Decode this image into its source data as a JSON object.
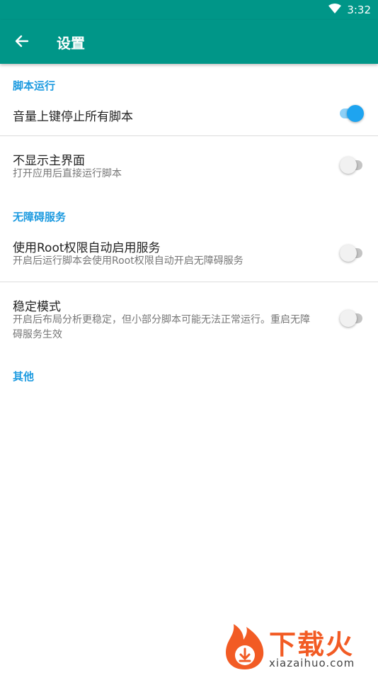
{
  "status_bar": {
    "time": "3:32",
    "icons": [
      "wifi-icon"
    ]
  },
  "app_bar": {
    "title": "设置",
    "back_icon": "arrow-back-icon"
  },
  "sections": {
    "script_run": {
      "header": "脚本运行",
      "items": [
        {
          "title": "音量上键停止所有脚本",
          "enabled": true
        },
        {
          "title": "不显示主界面",
          "subtitle": "打开应用后直接运行脚本",
          "enabled": false
        }
      ]
    },
    "accessibility": {
      "header": "无障碍服务",
      "items": [
        {
          "title": "使用Root权限自动启用服务",
          "subtitle": "开启后运行脚本会使用Root权限自动开启无障碍服务",
          "enabled": false
        },
        {
          "title": "稳定模式",
          "subtitle": "开启后布局分析更稳定，但小部分脚本可能无法正常运行。重启无障碍服务生效",
          "enabled": false
        }
      ]
    },
    "other": {
      "header": "其他"
    }
  },
  "watermark": {
    "brand": "下载火",
    "url": "xiazaihuo.com"
  },
  "colors": {
    "appbar": "#009688",
    "accent": "#1e9be0",
    "switch_on": "#1ea4f0",
    "brand_orange": "#f25b24"
  }
}
